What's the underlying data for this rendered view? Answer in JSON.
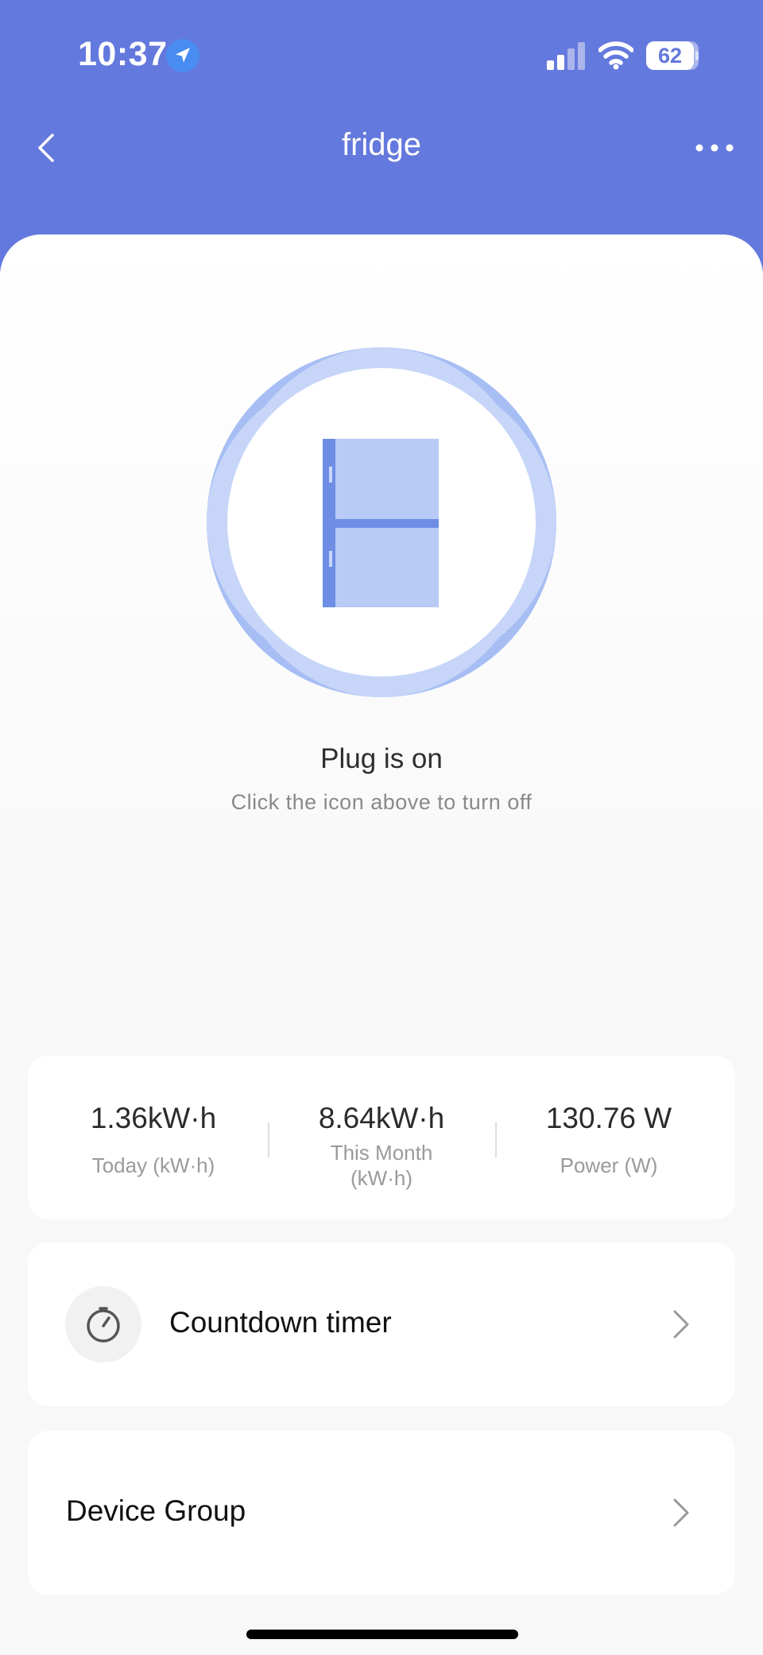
{
  "status_bar": {
    "time": "10:37",
    "battery": "62",
    "icons": [
      "location-arrow-icon",
      "cellular-signal-icon",
      "wifi-icon",
      "battery-icon"
    ]
  },
  "nav": {
    "title": "fridge",
    "back_icon": "chevron-left-icon",
    "more_icon": "more-dots-icon"
  },
  "device": {
    "icon": "fridge-icon",
    "status_title": "Plug is on",
    "status_hint": "Click the icon above to turn off"
  },
  "stats": [
    {
      "value": "1.36kW·h",
      "label": "Today (kW·h)"
    },
    {
      "value": "8.64kW·h",
      "label": "This Month (kW·h)"
    },
    {
      "value": "130.76 W",
      "label": "Power (W)"
    }
  ],
  "rows": {
    "countdown": {
      "label": "Countdown timer",
      "icon": "stopwatch-icon"
    },
    "device_group": {
      "label": "Device Group"
    }
  },
  "colors": {
    "header": "#6479dd",
    "ring": "#a5bdf4",
    "fridge_body": "#b6c9f6",
    "fridge_accent": "#6e8ee6",
    "background": "#f8f8f9"
  }
}
